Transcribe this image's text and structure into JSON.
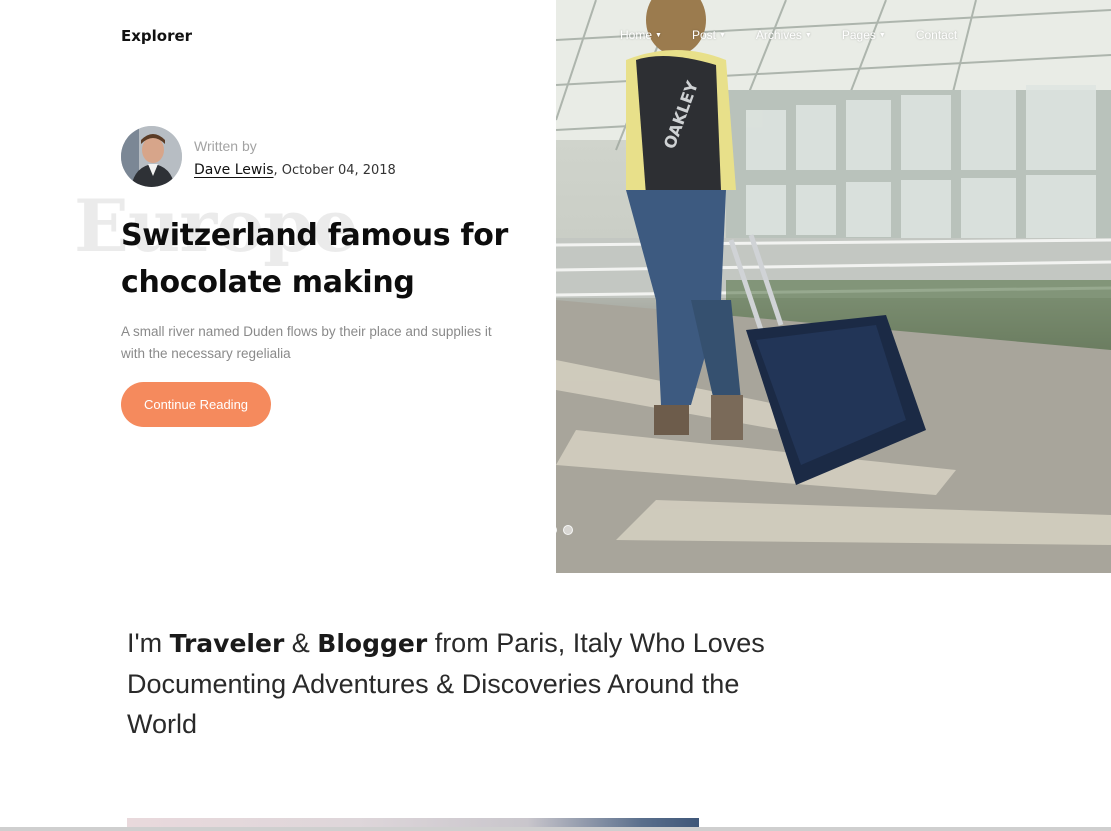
{
  "brand": "Explorer",
  "nav": [
    {
      "label": "Home",
      "dropdown": true
    },
    {
      "label": "Post",
      "dropdown": true
    },
    {
      "label": "Archives",
      "dropdown": true
    },
    {
      "label": "Pages",
      "dropdown": true
    },
    {
      "label": "Contact",
      "dropdown": false
    }
  ],
  "hero": {
    "written_by": "Written by",
    "author": "Dave Lewis",
    "date": ", October 04, 2018",
    "bg_word": "Europe",
    "title": "Switzerland famous for chocolate making",
    "excerpt": "A small river named Duden flows by their place and supplies it with the necessary regelialia",
    "cta": "Continue Reading",
    "slides": 2
  },
  "intro": {
    "p1": "I'm ",
    "b1": "Traveler",
    "p2": " & ",
    "b2": "Blogger",
    "p3": " from Paris, Italy Who Loves Documenting Adventures & Discoveries Around the World"
  },
  "colors": {
    "accent": "#f58a5d",
    "text": "#111111",
    "muted": "#8a8a8a"
  },
  "icons": [
    "chevron-down-icon"
  ]
}
